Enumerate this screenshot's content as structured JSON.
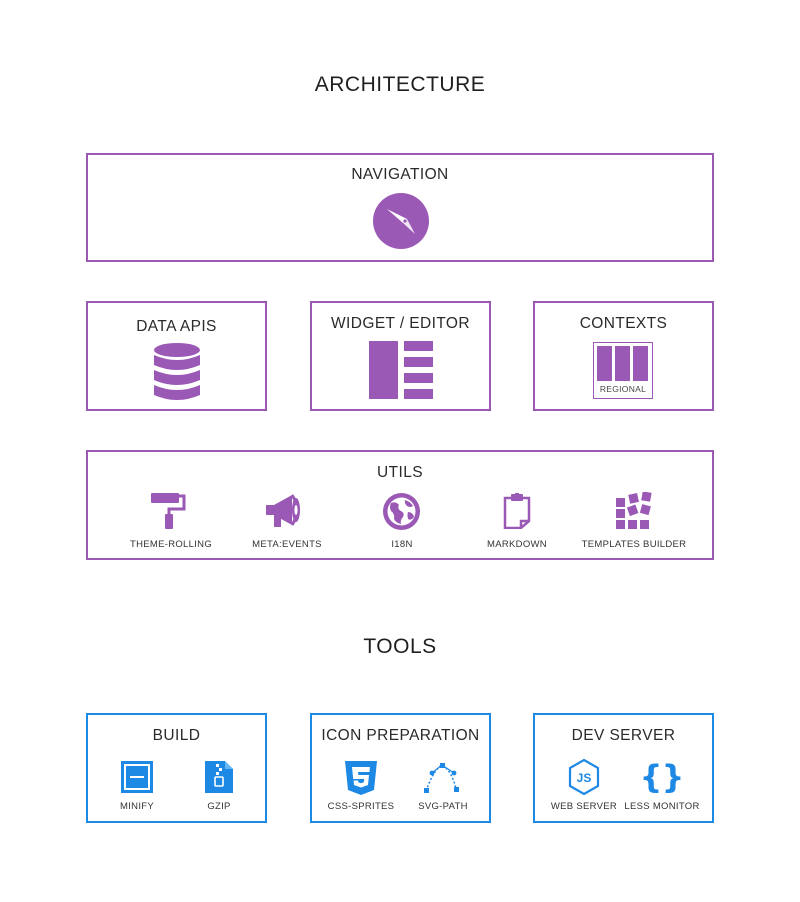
{
  "colors": {
    "purple": "#9b59b6",
    "blue": "#1e88e5"
  },
  "architecture": {
    "title": "ARCHITECTURE",
    "navigation": {
      "title": "NAVIGATION",
      "icon": "compass-icon"
    },
    "data_apis": {
      "title": "DATA APIS",
      "icon": "database-icon"
    },
    "widget_editor": {
      "title": "WIDGET / EDITOR",
      "icon": "widget-layout-icon"
    },
    "contexts": {
      "title": "CONTEXTS",
      "icon": "columns-icon",
      "caption": "REGIONAL"
    },
    "utils": {
      "title": "UTILS",
      "items": [
        {
          "label": "THEME-ROLLING",
          "icon": "paint-roller-icon"
        },
        {
          "label": "META:EVENTS",
          "icon": "megaphone-icon"
        },
        {
          "label": "I18N",
          "icon": "globe-icon"
        },
        {
          "label": "MARKDOWN",
          "icon": "clipboard-icon"
        },
        {
          "label": "TEMPLATES BUILDER",
          "icon": "blocks-icon"
        }
      ]
    }
  },
  "tools": {
    "title": "TOOLS",
    "build": {
      "title": "BUILD",
      "items": [
        {
          "label": "MINIFY",
          "icon": "minify-icon"
        },
        {
          "label": "GZIP",
          "icon": "zip-file-icon"
        }
      ]
    },
    "icon_preparation": {
      "title": "ICON PREPARATION",
      "items": [
        {
          "label": "CSS-SPRITES",
          "icon": "css3-icon"
        },
        {
          "label": "SVG-PATH",
          "icon": "bezier-path-icon"
        }
      ]
    },
    "dev_server": {
      "title": "DEV SERVER",
      "items": [
        {
          "label": "WEB SERVER",
          "icon": "nodejs-icon"
        },
        {
          "label": "LESS MONITOR",
          "icon": "braces-icon"
        }
      ]
    }
  }
}
